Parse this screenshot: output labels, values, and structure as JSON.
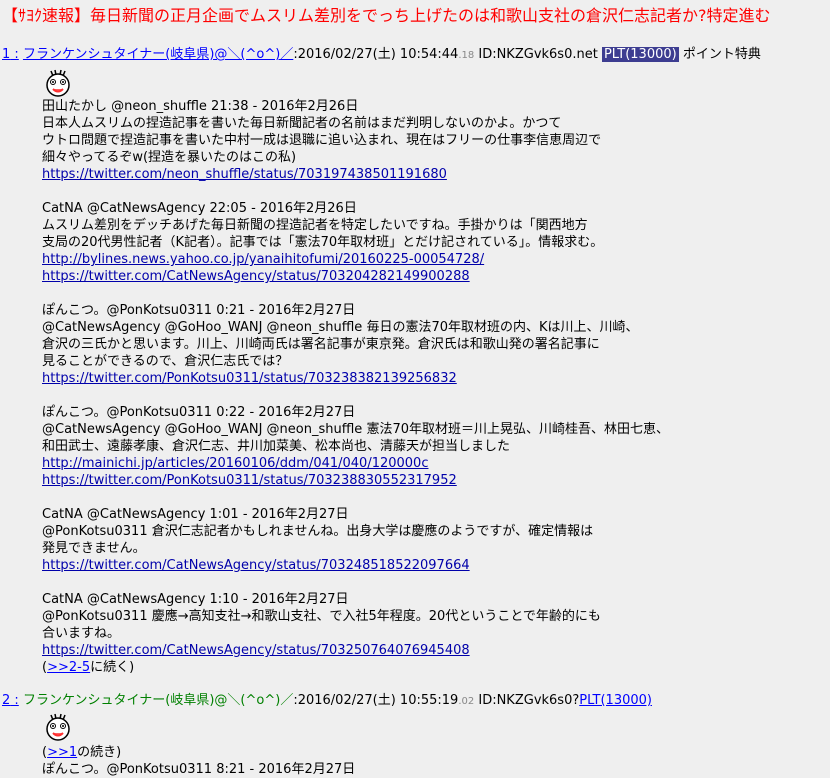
{
  "thread_title": "【ｻﾖｸ速報】毎日新聞の正月企画でムスリム差別をでっち上げたのは和歌山支社の倉沢仁志記者か?特定進む",
  "posts": [
    {
      "number": "1",
      "name": "フランケンシュタイナー(岐阜県)@＼(^o^)／",
      "date": "2016/02/27(土) 10:54:44",
      "msec": ".18",
      "id": "ID:NKZGvk6s0.net",
      "plt": "PLT(13000)",
      "extra": "ポイント特典",
      "blocks": [
        {
          "lines": [
            "田山たかし @neon_shuffle 21:38 - 2016年2月26日",
            "日本人ムスリムの捏造記事を書いた毎日新聞記者の名前はまだ判明しないのかよ。かつて",
            "ウトロ問題で捏造記事を書いた中村一成は退職に追い込まれ、現在はフリーの仕事李信恵周辺で",
            "細々やってるぞw(捏造を暴いたのはこの私)"
          ],
          "urls": [
            "https://twitter.com/neon_shuffle/status/703197438501191680"
          ]
        },
        {
          "lines": [
            "CatNA @CatNewsAgency 22:05 - 2016年2月26日",
            "ムスリム差別をデッチあげた毎日新聞の捏造記者を特定したいですね。手掛かりは「関西地方",
            "支局の20代男性記者（K記者）。記事では「憲法70年取材班」とだけ記されている」。情報求む。"
          ],
          "urls": [
            "http://bylines.news.yahoo.co.jp/yanaihitofumi/20160225-00054728/",
            "https://twitter.com/CatNewsAgency/status/703204282149900288"
          ]
        },
        {
          "lines": [
            "ぽんこつ。@PonKotsu0311 0:21 - 2016年2月27日",
            "@CatNewsAgency @GoHoo_WANJ @neon_shuffle 毎日の憲法70年取材班の内、Kは川上、川崎、",
            "倉沢の三氏かと思います。川上、川崎両氏は署名記事が東京発。倉沢氏は和歌山発の署名記事に",
            "見ることができるので、倉沢仁志氏では？"
          ],
          "urls": [
            "https://twitter.com/PonKotsu0311/status/703238382139256832"
          ]
        },
        {
          "lines": [
            "ぽんこつ。@PonKotsu0311 0:22 - 2016年2月27日",
            "@CatNewsAgency @GoHoo_WANJ @neon_shuffle 憲法70年取材班＝川上晃弘、川崎桂吾、林田七恵、",
            "和田武士、遠藤孝康、倉沢仁志、井川加菜美、松本尚也、清藤天が担当しました"
          ],
          "urls": [
            "http://mainichi.jp/articles/20160106/ddm/041/040/120000c",
            "https://twitter.com/PonKotsu0311/status/703238830552317952"
          ]
        },
        {
          "lines": [
            "CatNA @CatNewsAgency 1:01 - 2016年2月27日",
            "@PonKotsu0311 倉沢仁志記者かもしれませんね。出身大学は慶應のようですが、確定情報は",
            "発見できません。"
          ],
          "urls": [
            "https://twitter.com/CatNewsAgency/status/703248518522097664"
          ]
        },
        {
          "lines": [
            "CatNA @CatNewsAgency 1:10 - 2016年2月27日",
            "@PonKotsu0311 慶應→高知支社→和歌山支社、で入社5年程度。20代ということで年齢的にも",
            "合いますね。"
          ],
          "urls": [
            "https://twitter.com/CatNewsAgency/status/703250764076945408"
          ],
          "continue_anchor": ">>2-5",
          "continue_text": "に続く"
        }
      ]
    },
    {
      "number": "2",
      "name": "フランケンシュタイナー(岐阜県)@＼(^o^)／",
      "date": "2016/02/27(土) 10:55:19",
      "msec": ".02",
      "id": "ID:NKZGvk6s0?",
      "plt": "PLT(13000)",
      "anchor": ">>1",
      "anchor_text": "の続き",
      "first_line": "ぽんこつ。@PonKotsu0311 8:21 - 2016年2月27日"
    }
  ]
}
